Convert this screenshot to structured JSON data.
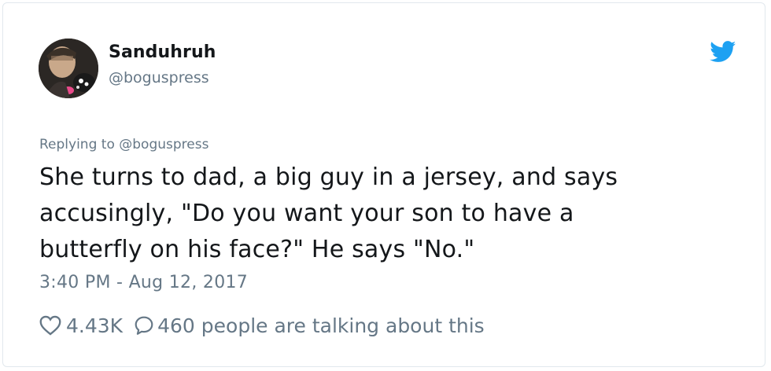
{
  "user": {
    "display_name": "Sanduhruh",
    "handle": "@boguspress",
    "avatar_icon": "avatar"
  },
  "brand": {
    "icon": "twitter-bird-icon",
    "color": "#1da1f2"
  },
  "reply": {
    "prefix": "Replying to",
    "mention": "@boguspress"
  },
  "tweet": {
    "line1": "She turns to dad, a big guy in a jersey, and says",
    "line2": "accusingly, \"Do you want your son to have a",
    "line3": "butterfly on his face?\" He says \"No.\"",
    "timestamp": "3:40 PM - Aug 12, 2017"
  },
  "actions": {
    "likes": "4.43K",
    "like_icon": "heart-icon",
    "talking_count": "460",
    "talking_icon": "speech-bubble-icon",
    "talking_label": "people are talking about this"
  },
  "colors": {
    "text": "#14171a",
    "muted": "#657786",
    "border": "#e1e8ed"
  }
}
